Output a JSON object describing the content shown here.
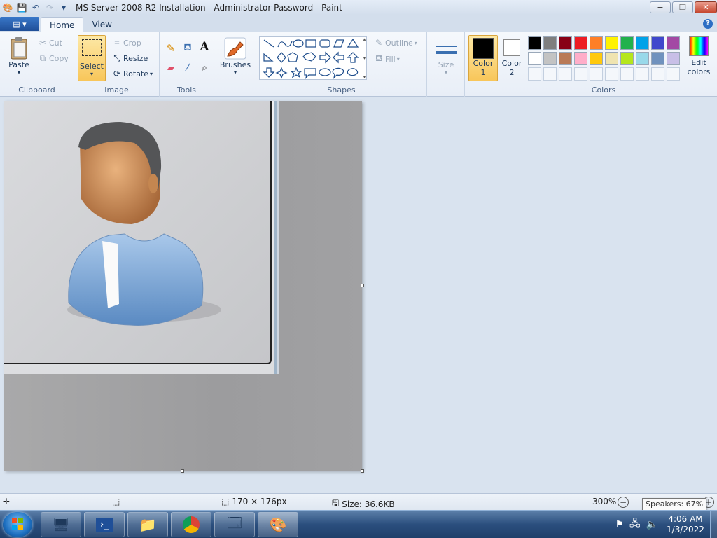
{
  "window": {
    "title": "MS Server 2008 R2 Installation - Administrator Password - Paint",
    "minimize_label": "−",
    "restore_label": "❐",
    "close_label": "✕"
  },
  "tabs": [
    {
      "label": "Home",
      "active": true
    },
    {
      "label": "View",
      "active": false
    }
  ],
  "ribbon": {
    "clipboard": {
      "label": "Clipboard",
      "paste": "Paste",
      "cut": "Cut",
      "copy": "Copy"
    },
    "image": {
      "label": "Image",
      "select": "Select",
      "crop": "Crop",
      "resize": "Resize",
      "rotate": "Rotate"
    },
    "tools": {
      "label": "Tools"
    },
    "brushes": {
      "label": "Brushes"
    },
    "shapes": {
      "label": "Shapes",
      "outline": "Outline",
      "fill": "Fill"
    },
    "size": {
      "label": "Size"
    },
    "color1": {
      "line1": "Color",
      "line2": "1"
    },
    "color2": {
      "line1": "Color",
      "line2": "2"
    },
    "colors": {
      "label": "Colors",
      "edit_line1": "Edit",
      "edit_line2": "colors"
    }
  },
  "palette_row1": [
    "#000000",
    "#7f7f7f",
    "#880015",
    "#ed1c24",
    "#ff7f27",
    "#fff200",
    "#22b14c",
    "#00a2e8",
    "#3f48cc",
    "#a349a4"
  ],
  "palette_row2": [
    "#ffffff",
    "#c3c3c3",
    "#b97a57",
    "#ffaec9",
    "#ffc90e",
    "#efe4b0",
    "#b5e61d",
    "#99d9ea",
    "#7092be",
    "#c8bfe7"
  ],
  "color1_value": "#000000",
  "color2_value": "#ffffff",
  "status": {
    "dimensions": "170 × 176px",
    "size": "Size: 36.6KB",
    "zoom": "300%"
  },
  "tooltip": "Speakers: 67%",
  "clock": {
    "time": "4:06 AM",
    "date": "1/3/2022"
  }
}
